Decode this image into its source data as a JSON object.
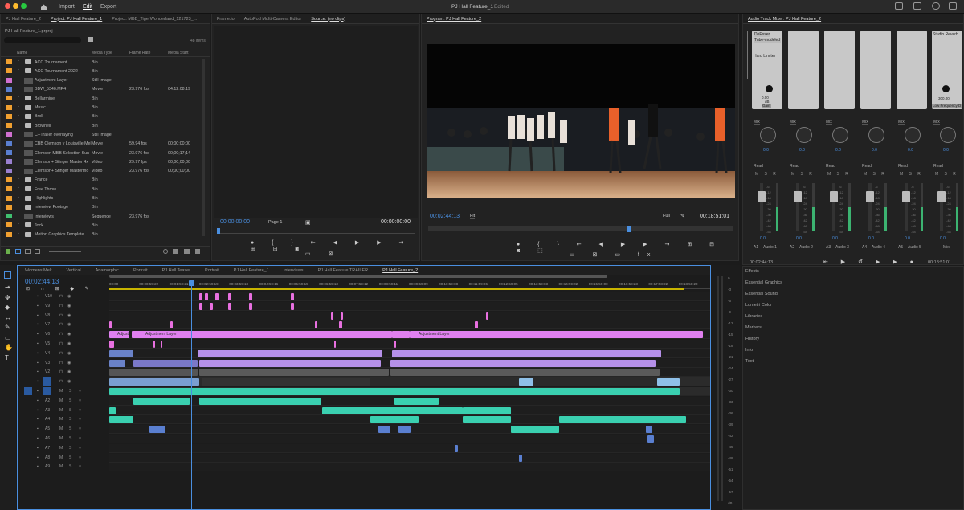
{
  "titlebar": {
    "home_label": "Home",
    "import": "Import",
    "edit": "Edit",
    "export": "Export",
    "doc_title": "PJ Hall Feature_1",
    "status": "Edited"
  },
  "project": {
    "tabs": [
      "PJ Hall Feature_2",
      "Project: PJ Hall Feature_1",
      "Project: MBB_TigerWonderland_121723_..."
    ],
    "file": "PJ Hall Feature_1.prproj",
    "count": "48 items",
    "columns": [
      "Name",
      "Media Type",
      "Frame Rate",
      "Media Start"
    ],
    "items": [
      {
        "name": "ACC Tournament",
        "type": "Bin",
        "fps": "",
        "start": "",
        "color": "#f0a030",
        "kind": "folder"
      },
      {
        "name": "ACC Tournament 2022",
        "type": "Bin",
        "fps": "",
        "start": "",
        "color": "#f0a030",
        "kind": "folder"
      },
      {
        "name": "Adjustment Layer",
        "type": "Still Image",
        "fps": "",
        "start": "",
        "color": "#d070d0",
        "kind": "thumb"
      },
      {
        "name": "BBW_5340.MP4",
        "type": "Movie",
        "fps": "23.976 fps",
        "start": "04:12:08:19",
        "color": "#5a7fd0",
        "kind": "thumb"
      },
      {
        "name": "Bellarmine",
        "type": "Bin",
        "fps": "",
        "start": "",
        "color": "#f0a030",
        "kind": "folder"
      },
      {
        "name": "Music",
        "type": "Bin",
        "fps": "",
        "start": "",
        "color": "#f0a030",
        "kind": "folder"
      },
      {
        "name": "Broll",
        "type": "Bin",
        "fps": "",
        "start": "",
        "color": "#f0a030",
        "kind": "folder"
      },
      {
        "name": "Brownell",
        "type": "Bin",
        "fps": "",
        "start": "",
        "color": "#f0a030",
        "kind": "folder"
      },
      {
        "name": "C--Trailer overlaying",
        "type": "Still Image",
        "fps": "",
        "start": "",
        "color": "#d070d0",
        "kind": "thumb"
      },
      {
        "name": "CBB Clemson v Louisville Mel",
        "type": "Movie",
        "fps": "59.94 fps",
        "start": "00;00;00;00",
        "color": "#5a7fd0",
        "kind": "thumb"
      },
      {
        "name": "Clemson MBB Selection Sun",
        "type": "Movie",
        "fps": "23.976 fps",
        "start": "00;00;17;14",
        "color": "#5a7fd0",
        "kind": "thumb"
      },
      {
        "name": "Clemson+ Stinger Master 4x",
        "type": "Video",
        "fps": "29.97 fps",
        "start": "00;00;00;00",
        "color": "#9a80d0",
        "kind": "thumb"
      },
      {
        "name": "Clemson+ Stinger Mastermo",
        "type": "Video",
        "fps": "23.976 fps",
        "start": "00;00;00;00",
        "color": "#9a80d0",
        "kind": "thumb"
      },
      {
        "name": "France",
        "type": "Bin",
        "fps": "",
        "start": "",
        "color": "#f0a030",
        "kind": "folder"
      },
      {
        "name": "Free Throw",
        "type": "Bin",
        "fps": "",
        "start": "",
        "color": "#f0a030",
        "kind": "folder"
      },
      {
        "name": "Highlights",
        "type": "Bin",
        "fps": "",
        "start": "",
        "color": "#f0a030",
        "kind": "folder"
      },
      {
        "name": "Interview Footage",
        "type": "Bin",
        "fps": "",
        "start": "",
        "color": "#f0a030",
        "kind": "folder"
      },
      {
        "name": "Interviews",
        "type": "Sequence",
        "fps": "23.976 fps",
        "start": "",
        "color": "#40c070",
        "kind": "thumb"
      },
      {
        "name": "Jock",
        "type": "Bin",
        "fps": "",
        "start": "",
        "color": "#f0a030",
        "kind": "folder"
      },
      {
        "name": "Motion Graphics Template",
        "type": "Bin",
        "fps": "",
        "start": "",
        "color": "#f0a030",
        "kind": "folder"
      }
    ]
  },
  "source": {
    "tabs": [
      "Frame.io",
      "AutoPod Multi-Camera Editor",
      "Source: (no clips)"
    ],
    "tc_in": "00:00:00:00",
    "page": "Page 1",
    "tc_out": "00:00:00:00"
  },
  "program": {
    "tab": "Program: PJ Hall Feature_2",
    "tc": "00:02:44:13",
    "fit": "Fit",
    "quality": "Full",
    "duration": "00:18:51:01"
  },
  "mixer": {
    "tab": "Audio Track Mixer: PJ Hall Feature_2",
    "fx_labels": [
      "DeEsser",
      "Tube-modeled",
      "Hard Limiter"
    ],
    "gain": "0.00",
    "gain_unit": "dB",
    "gain_label": "Gain",
    "fx2_label": "Studio Reverb",
    "fx2_val": "300.00",
    "fx2_label2": "Low Frequency D",
    "pan_label": "Mix",
    "pan_val": "0.0",
    "read": "Read",
    "channels": [
      "Audio 1",
      "Audio 2",
      "Audio 3",
      "Audio 4",
      "Audio 5",
      "Mix"
    ],
    "channel_ids": [
      "A1",
      "A2",
      "A3",
      "A4",
      "A5"
    ],
    "db_ticks": [
      "-6",
      "-12",
      "-18",
      "-24",
      "-30",
      "-36",
      "-42",
      "-48",
      "-54"
    ],
    "tc": "00:02:44:13",
    "end": "00:18:51:01"
  },
  "timeline": {
    "tabs": [
      "Womens Melt",
      "Vertical",
      "Anamorphic",
      "Portrait",
      "PJ Hall Teaser",
      "Portrait",
      "PJ Hall Feature_1",
      "Interviews",
      "PJ Hall Feature TRAILER",
      "PJ Hall Feature_2"
    ],
    "tc": "00:02:44:13",
    "ruler": [
      "00:00",
      "00:00:59:22",
      "00:01:59:21",
      "00:02:59:19",
      "00:03:59:18",
      "00:04:59:16",
      "00:05:59:15",
      "00:06:59:13",
      "00:07:59:12",
      "00:08:59:11",
      "00:09:59:09",
      "00:10:59:08",
      "00:11:59:06",
      "00:12:59:05",
      "00:13:59:03",
      "00:14:59:02",
      "00:15:59:00",
      "00:16:58:23",
      "00:17:58:22",
      "00:18:58:20"
    ],
    "tracks": [
      "V10",
      "V9",
      "V8",
      "V7",
      "V6",
      "V5",
      "V4",
      "V3",
      "V2",
      "V1",
      "A1",
      "A2",
      "A3",
      "A4",
      "A5",
      "A6",
      "A7",
      "A8",
      "A9"
    ],
    "adjust_labels": [
      "Adjust",
      "Adjustment Layer",
      "Adjustment Layer"
    ],
    "meter_ticks": [
      "0",
      "-3",
      "-6",
      "-9",
      "-12",
      "-15",
      "-18",
      "-21",
      "-24",
      "-27",
      "-30",
      "-33",
      "-36",
      "-39",
      "-42",
      "-45",
      "-48",
      "-51",
      "-54",
      "-57"
    ],
    "db_unit": "dB"
  },
  "right_panels": [
    "Effects",
    "Essential Graphics",
    "Essential Sound",
    "Lumetri Color",
    "Libraries",
    "Markers",
    "History",
    "Info",
    "Text"
  ]
}
